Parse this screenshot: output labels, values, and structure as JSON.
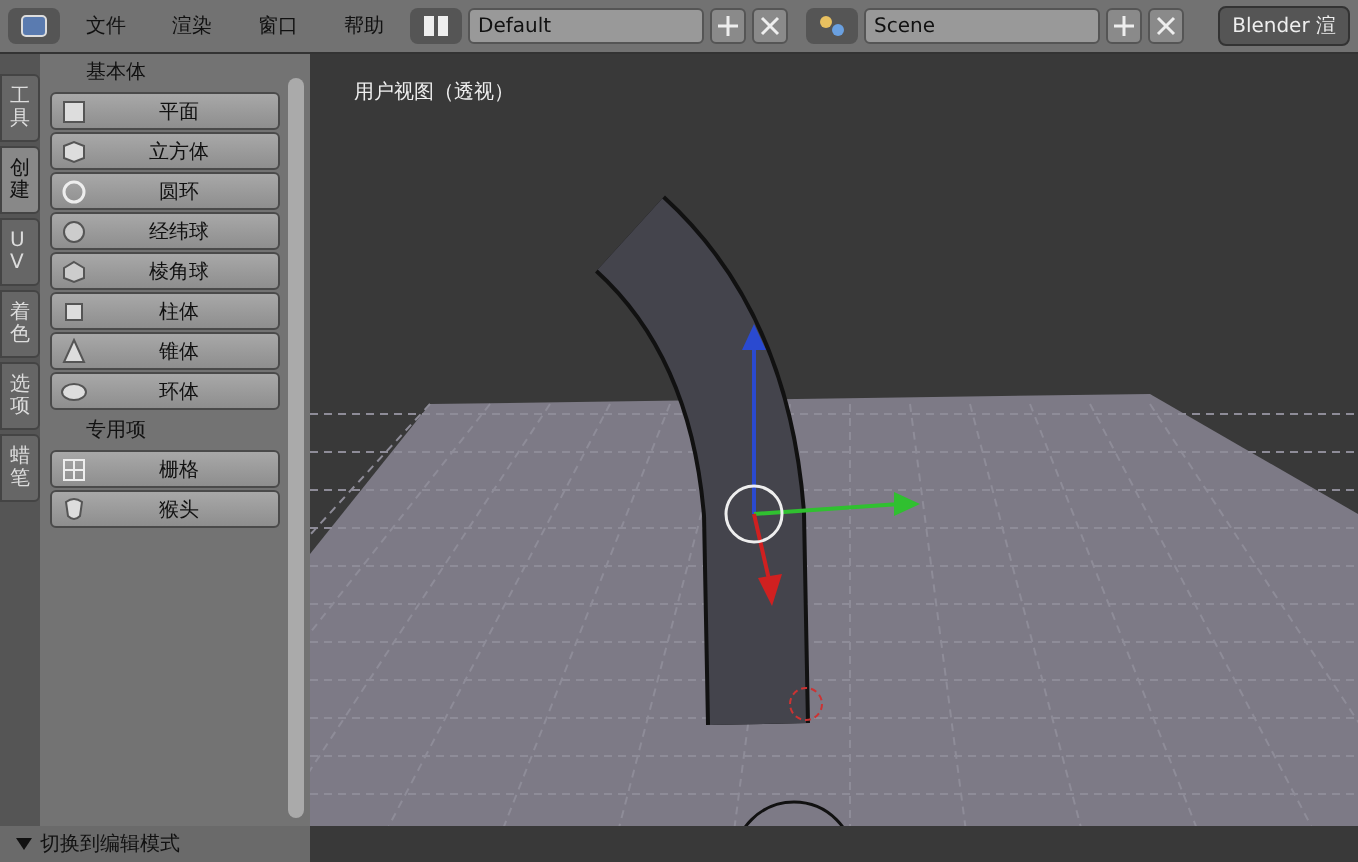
{
  "header": {
    "menus": [
      "文件",
      "渲染",
      "窗口",
      "帮助"
    ],
    "layout": {
      "value": "Default"
    },
    "scene": {
      "value": "Scene"
    },
    "render_engine": "Blender 渲"
  },
  "tool_tabs": [
    {
      "label": "工具",
      "selected": false
    },
    {
      "label": "创建",
      "selected": true
    },
    {
      "label": "UV",
      "selected": false
    },
    {
      "label": "着色",
      "selected": false
    },
    {
      "label": "选项",
      "selected": false
    },
    {
      "label": "蜡笔",
      "selected": false
    }
  ],
  "sections": [
    {
      "title": "基本体",
      "buttons": [
        {
          "label": "平面",
          "kind": "plane"
        },
        {
          "label": "立方体",
          "kind": "cube"
        },
        {
          "label": "圆环",
          "kind": "circle"
        },
        {
          "label": "经纬球",
          "kind": "uvsphere"
        },
        {
          "label": "棱角球",
          "kind": "icosphere"
        },
        {
          "label": "柱体",
          "kind": "cylinder"
        },
        {
          "label": "锥体",
          "kind": "cone"
        },
        {
          "label": "环体",
          "kind": "torus"
        }
      ]
    },
    {
      "title": "专用项",
      "buttons": [
        {
          "label": "栅格",
          "kind": "grid"
        },
        {
          "label": "猴头",
          "kind": "monkey"
        }
      ]
    }
  ],
  "operator_panel": {
    "title": "切换到编辑模式",
    "expanded": true
  },
  "viewport": {
    "label": "用户视图（透视）"
  }
}
